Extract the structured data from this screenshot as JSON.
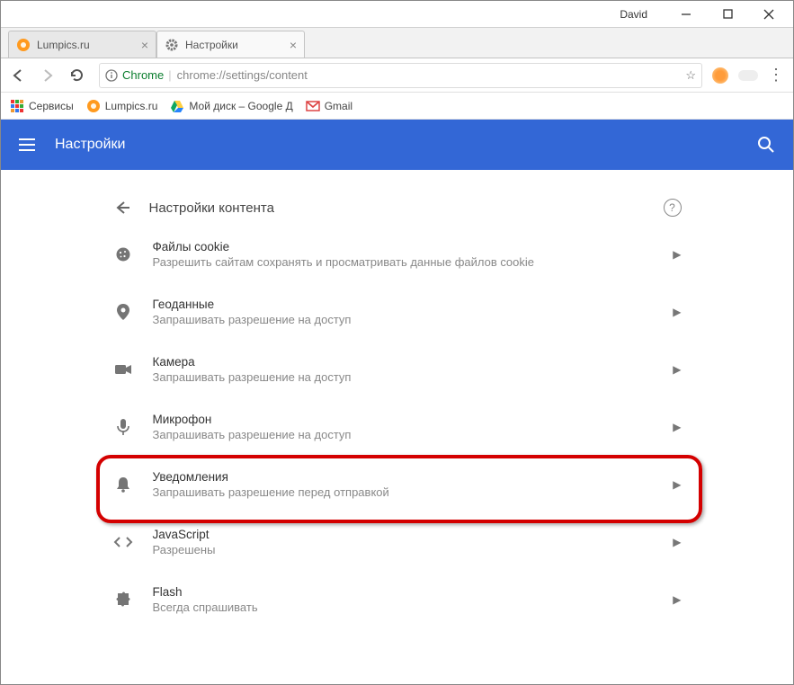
{
  "window": {
    "user": "David"
  },
  "tabs": [
    {
      "title": "Lumpics.ru",
      "favicon": "orange-circle"
    },
    {
      "title": "Настройки",
      "favicon": "gear"
    }
  ],
  "address": {
    "scheme_label": "Chrome",
    "url": "chrome://settings/content"
  },
  "bookmarks": [
    {
      "label": "Сервисы",
      "icon": "apps"
    },
    {
      "label": "Lumpics.ru",
      "icon": "orange-circle"
    },
    {
      "label": "Мой диск – Google Д",
      "icon": "drive"
    },
    {
      "label": "Gmail",
      "icon": "gmail"
    }
  ],
  "header": {
    "title": "Настройки"
  },
  "page": {
    "title": "Настройки контента",
    "rows": [
      {
        "icon": "cookie",
        "title": "Файлы cookie",
        "sub": "Разрешить сайтам сохранять и просматривать данные файлов cookie"
      },
      {
        "icon": "location",
        "title": "Геоданные",
        "sub": "Запрашивать разрешение на доступ"
      },
      {
        "icon": "camera",
        "title": "Камера",
        "sub": "Запрашивать разрешение на доступ"
      },
      {
        "icon": "mic",
        "title": "Микрофон",
        "sub": "Запрашивать разрешение на доступ"
      },
      {
        "icon": "bell",
        "title": "Уведомления",
        "sub": "Запрашивать разрешение перед отправкой"
      },
      {
        "icon": "code",
        "title": "JavaScript",
        "sub": "Разрешены"
      },
      {
        "icon": "puzzle",
        "title": "Flash",
        "sub": "Всегда спрашивать"
      }
    ]
  }
}
